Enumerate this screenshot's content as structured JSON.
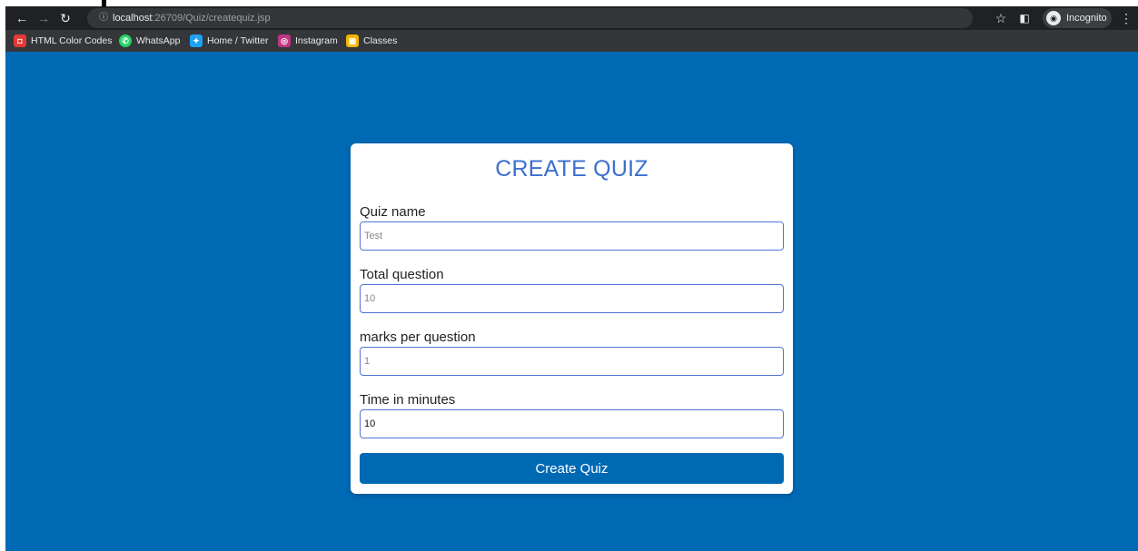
{
  "browser": {
    "url_host": "localhost",
    "url_path": ":26709/Quiz/createquiz.jsp",
    "incognito_label": "Incognito",
    "bookmarks": [
      {
        "label": "HTML Color Codes",
        "color": "#e53935"
      },
      {
        "label": "WhatsApp",
        "color": "#25d366"
      },
      {
        "label": "Home / Twitter",
        "color": "#1da1f2"
      },
      {
        "label": "Instagram",
        "color": "#c13584"
      },
      {
        "label": "Classes",
        "color": "#f2b600"
      }
    ]
  },
  "form": {
    "title": "CREATE QUIZ",
    "fields": [
      {
        "label": "Quiz name",
        "value": "",
        "placeholder": "Test"
      },
      {
        "label": "Total question",
        "value": "",
        "placeholder": "10"
      },
      {
        "label": "marks per question",
        "value": "",
        "placeholder": "1"
      },
      {
        "label": "Time in minutes",
        "value": "10",
        "placeholder": ""
      }
    ],
    "submit_label": "Create Quiz"
  },
  "colors": {
    "page_bg": "#0069b4",
    "title": "#3d6fd1",
    "field_border": "#5071d6",
    "button_bg": "#0069b4"
  }
}
